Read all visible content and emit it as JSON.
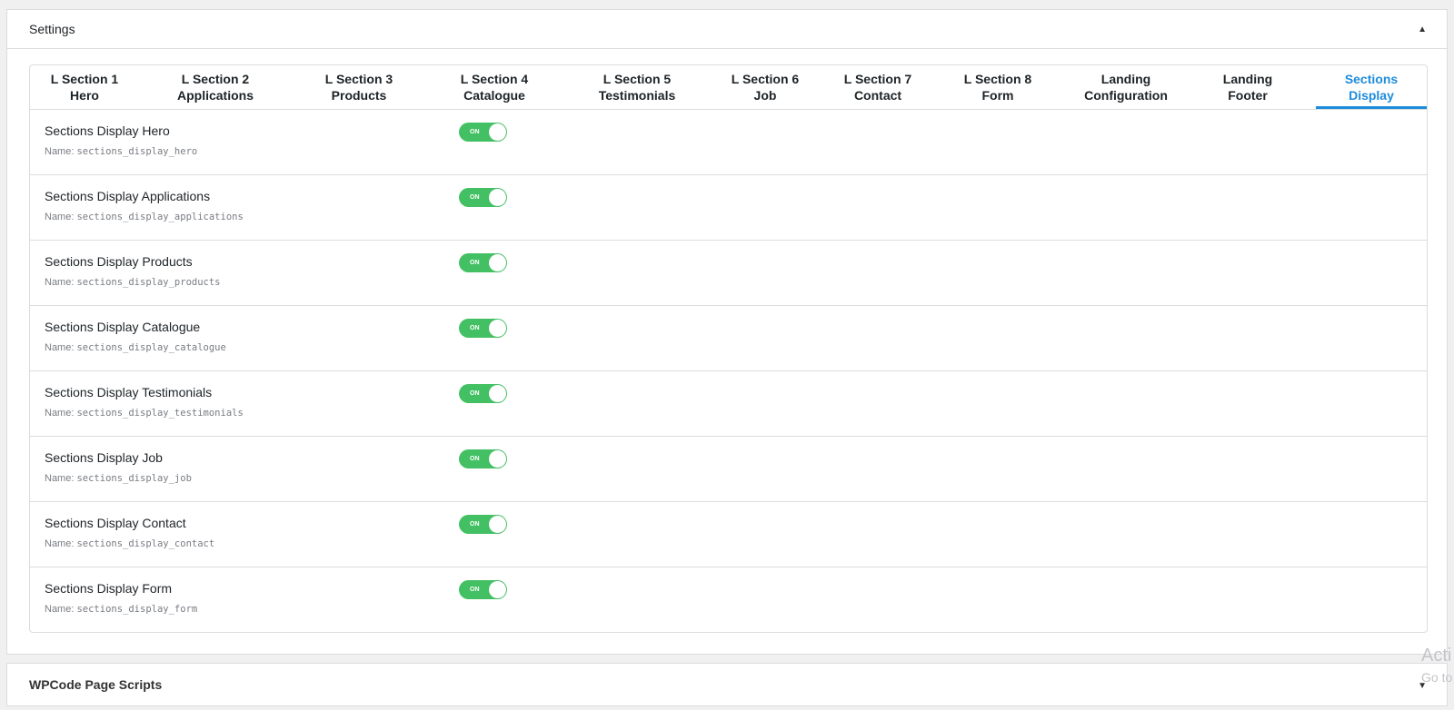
{
  "settings": {
    "title": "Settings",
    "collapse_icon": "▲"
  },
  "tabs": [
    {
      "label": "L Section 1\nHero",
      "active": false
    },
    {
      "label": "L Section 2\nApplications",
      "active": false
    },
    {
      "label": "L Section 3\nProducts",
      "active": false
    },
    {
      "label": "L Section 4\nCatalogue",
      "active": false
    },
    {
      "label": "L Section 5\nTestimonials",
      "active": false
    },
    {
      "label": "L Section 6\nJob",
      "active": false
    },
    {
      "label": "L Section 7\nContact",
      "active": false
    },
    {
      "label": "L Section 8\nForm",
      "active": false
    },
    {
      "label": "Landing\nConfiguration",
      "active": false
    },
    {
      "label": "Landing\nFooter",
      "active": false
    },
    {
      "label": "Sections\nDisplay",
      "active": true
    }
  ],
  "fields": [
    {
      "label": "Sections Display Hero",
      "name_prefix": "Name: ",
      "name": "sections_display_hero",
      "toggle": "ON"
    },
    {
      "label": "Sections Display Applications",
      "name_prefix": "Name: ",
      "name": "sections_display_applications",
      "toggle": "ON"
    },
    {
      "label": "Sections Display Products",
      "name_prefix": "Name: ",
      "name": "sections_display_products",
      "toggle": "ON"
    },
    {
      "label": "Sections Display Catalogue",
      "name_prefix": "Name: ",
      "name": "sections_display_catalogue",
      "toggle": "ON"
    },
    {
      "label": "Sections Display Testimonials",
      "name_prefix": "Name: ",
      "name": "sections_display_testimonials",
      "toggle": "ON"
    },
    {
      "label": "Sections Display Job",
      "name_prefix": "Name: ",
      "name": "sections_display_job",
      "toggle": "ON"
    },
    {
      "label": "Sections Display Contact",
      "name_prefix": "Name: ",
      "name": "sections_display_contact",
      "toggle": "ON"
    },
    {
      "label": "Sections Display Form",
      "name_prefix": "Name: ",
      "name": "sections_display_form",
      "toggle": "ON"
    }
  ],
  "wpcode": {
    "title": "WPCode Page Scripts",
    "expand_icon": "▼"
  },
  "watermark": {
    "line1": "Acti",
    "line2": "Go to"
  },
  "colors": {
    "toggle_on": "#44c064",
    "active_tab": "#1e8cdc"
  }
}
